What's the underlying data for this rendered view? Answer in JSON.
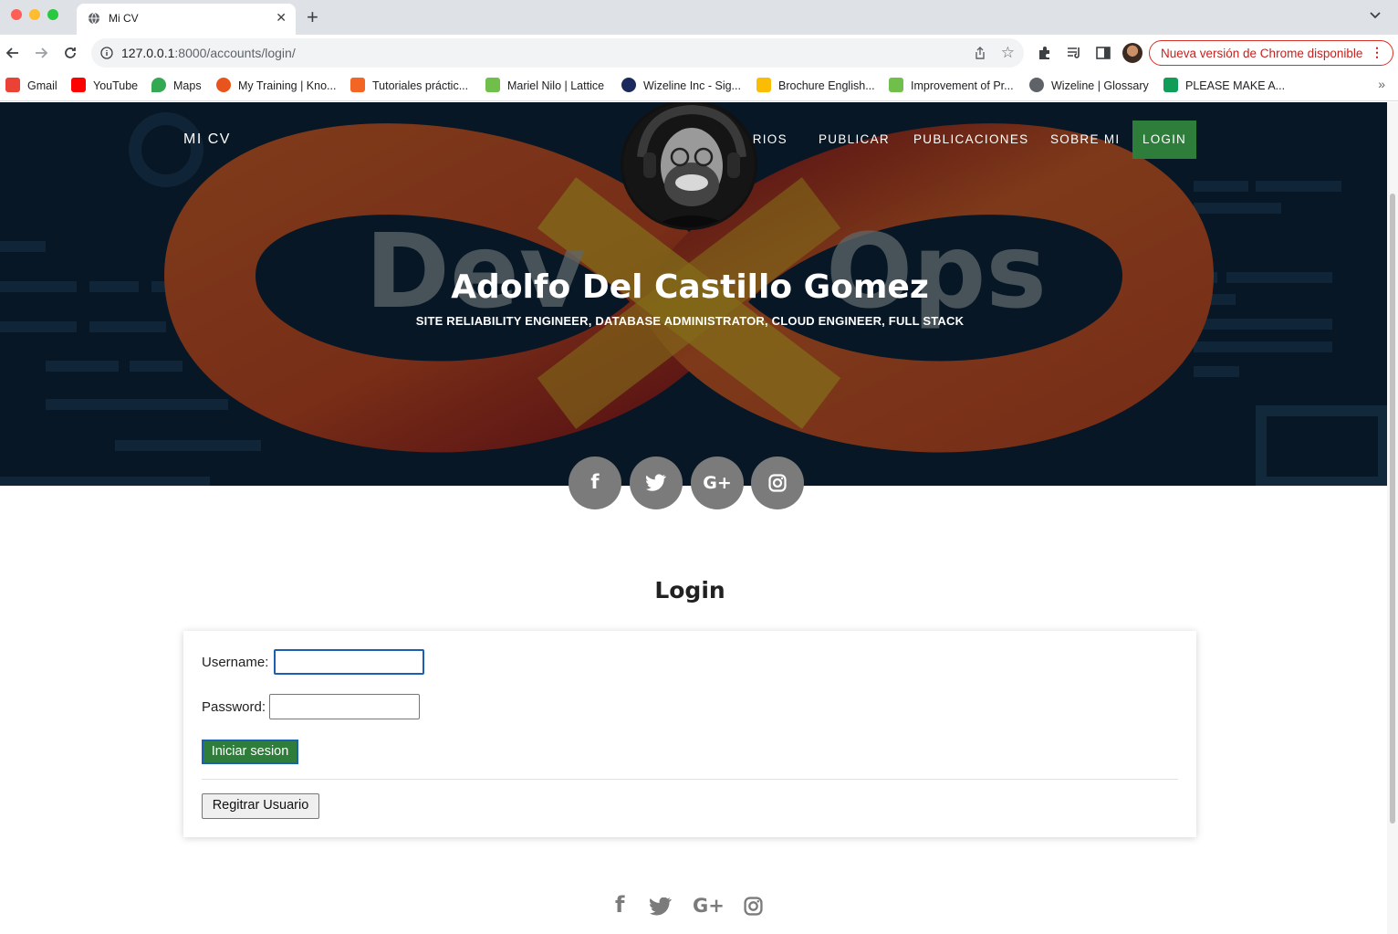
{
  "browser": {
    "tab_title": "Mi CV",
    "tab_close": "✕",
    "new_tab": "+",
    "url_host": "127.0.0.1",
    "url_rest": ":8000/accounts/login/",
    "update_label": "Nueva versión de Chrome disponible",
    "more_dots": "⋮",
    "bookmarks": [
      {
        "label": "Gmail",
        "icon": "gmail-icon",
        "color": "#ea4335"
      },
      {
        "label": "YouTube",
        "icon": "youtube-icon",
        "color": "#ff0000"
      },
      {
        "label": "Maps",
        "icon": "maps-icon",
        "color": "#34a853"
      },
      {
        "label": "My Training | Kno...",
        "icon": "training-icon",
        "color": "#e8541c"
      },
      {
        "label": "Tutoriales práctic...",
        "icon": "tutorials-icon",
        "color": "#f26522"
      },
      {
        "label": "Mariel Nilo | Lattice",
        "icon": "lattice-icon",
        "color": "#6fbf4a"
      },
      {
        "label": "Wizeline Inc - Sig...",
        "icon": "wizeline-icon",
        "color": "#1b2a5c"
      },
      {
        "label": "Brochure English...",
        "icon": "drive-icon",
        "color": "#fbbc04"
      },
      {
        "label": "Improvement of Pr...",
        "icon": "lattice-icon",
        "color": "#6fbf4a"
      },
      {
        "label": "Wizeline | Glossary",
        "icon": "globe-icon",
        "color": "#5f6368"
      },
      {
        "label": "PLEASE MAKE A...",
        "icon": "sheets-icon",
        "color": "#0f9d58"
      }
    ],
    "bookmarks_more": "»"
  },
  "nav": {
    "brand": "MI CV",
    "links": [
      "USUARIOS",
      "PUBLICAR",
      "PUBLICACIONES",
      "SOBRE MI"
    ],
    "login": "LOGIN"
  },
  "hero": {
    "bg_word_left": "Dev",
    "bg_word_right": "Ops",
    "name": "Adolfo Del Castillo Gomez",
    "subtitle": "SITE RELIABILITY ENGINEER, DATABASE ADMINISTRATOR, CLOUD ENGINEER, FULL STACK",
    "social": [
      {
        "glyph": "f",
        "icon": "facebook-icon"
      },
      {
        "glyph": "🐦",
        "icon": "twitter-icon"
      },
      {
        "glyph": "G+",
        "icon": "google-plus-icon"
      },
      {
        "glyph": "◎",
        "icon": "instagram-icon"
      }
    ]
  },
  "login": {
    "title": "Login",
    "username_label": "Username:",
    "password_label": "Password:",
    "submit": "Iniciar sesion",
    "register": "Regitrar Usuario"
  },
  "footer": {
    "icons": [
      "f",
      "🐦",
      "G+",
      "◎"
    ]
  },
  "colors": {
    "accent": "#2f7d3a",
    "social_bg": "#7b7b7b",
    "focus": "#1a5fb4"
  }
}
